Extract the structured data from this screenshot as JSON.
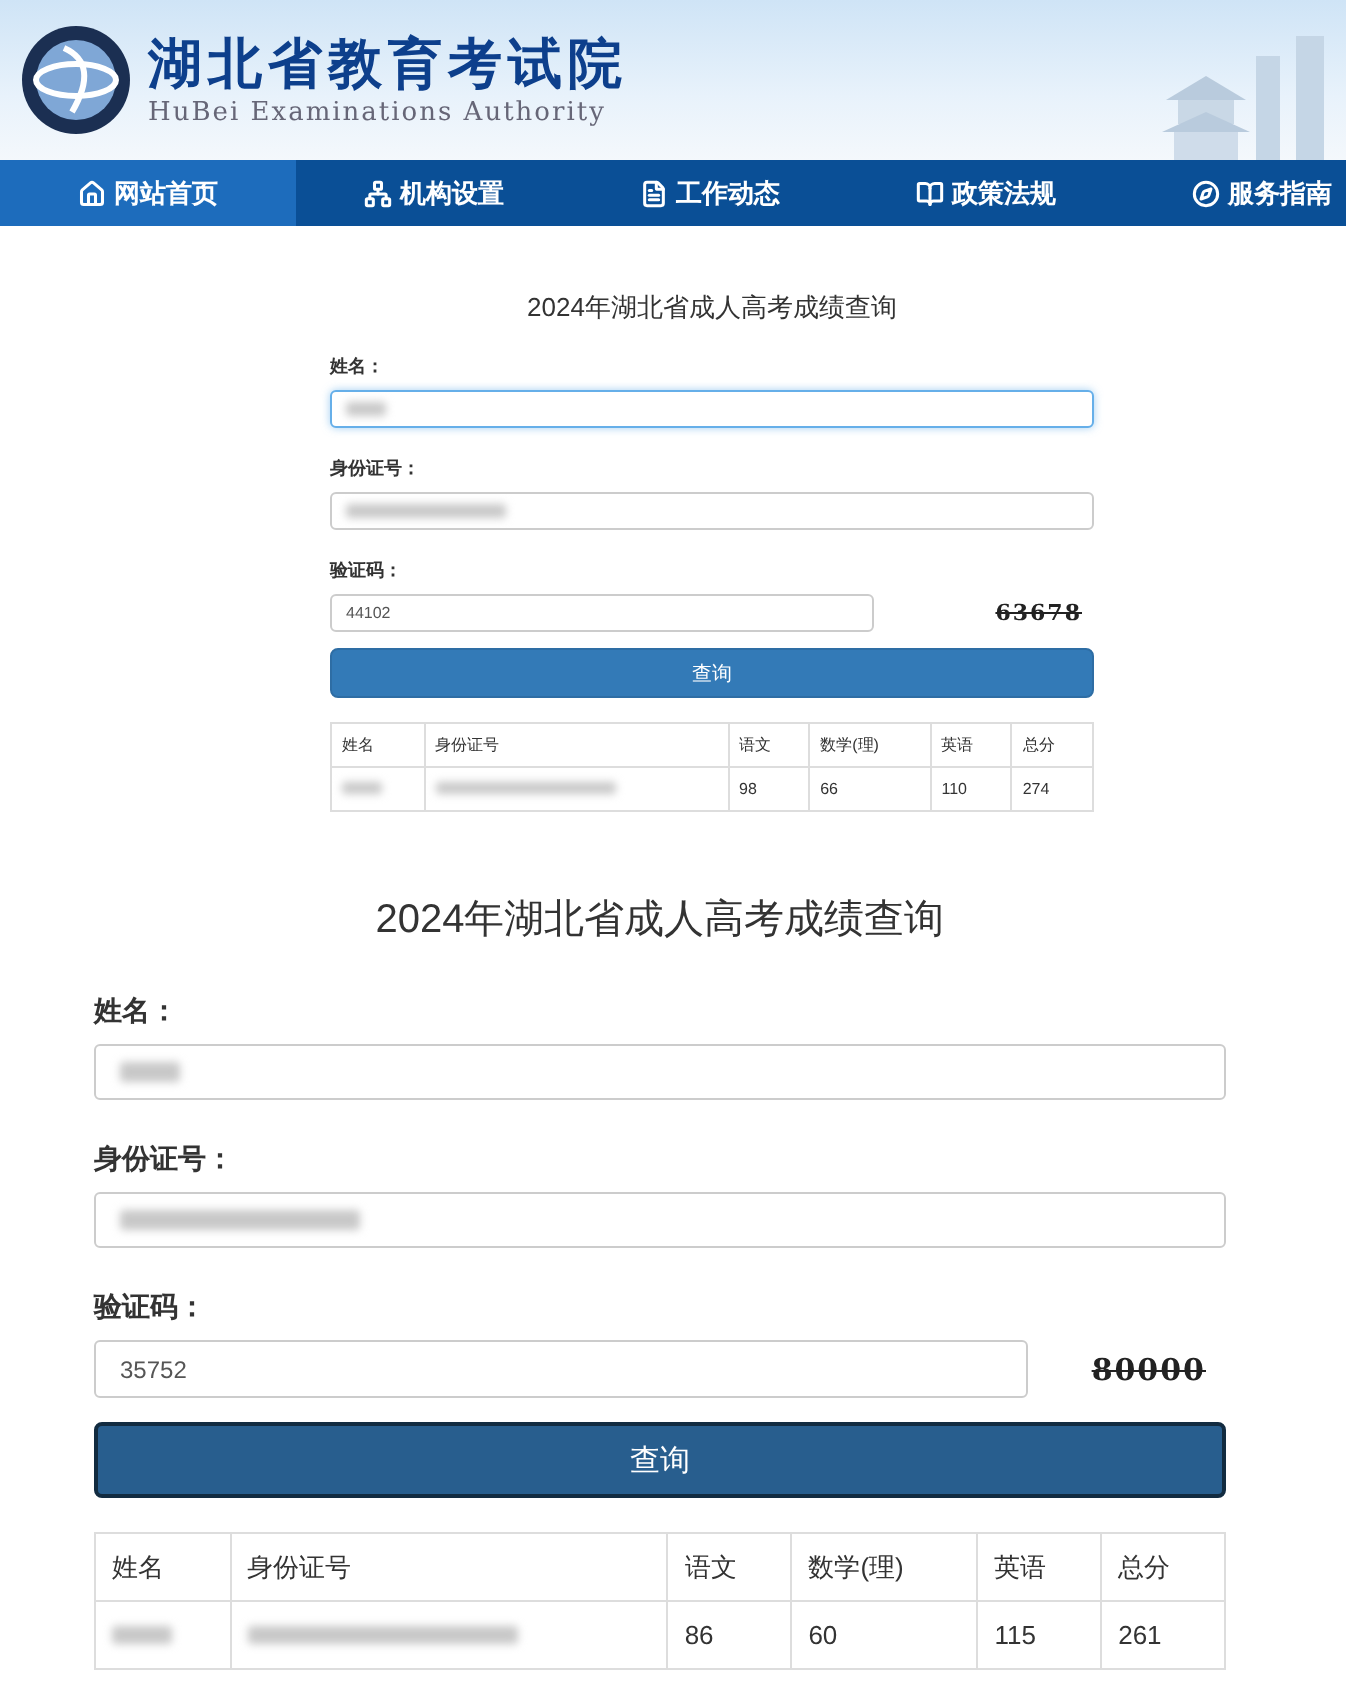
{
  "header": {
    "title": "湖北省教育考试院",
    "subtitle": "HuBei Examinations Authority"
  },
  "nav": [
    {
      "label": "网站首页",
      "selected": true
    },
    {
      "label": "机构设置",
      "selected": false
    },
    {
      "label": "工作动态",
      "selected": false
    },
    {
      "label": "政策法规",
      "selected": false
    },
    {
      "label": "服务指南",
      "selected": false
    }
  ],
  "forms": [
    {
      "kind": "compact",
      "title": "2024年湖北省成人高考成绩查询",
      "fields": [
        {
          "label": "姓名：",
          "redacted": true,
          "focused": true
        },
        {
          "label": "身份证号：",
          "redacted": true,
          "focused": false
        }
      ],
      "captcha": {
        "label": "验证码：",
        "value": "44102",
        "code": "63678"
      },
      "button": "查询",
      "columns": [
        "姓名",
        "身份证号",
        "语文",
        "数学(理)",
        "英语",
        "总分"
      ],
      "rows": [
        [
          {
            "redacted": true
          },
          {
            "redacted": true
          },
          {
            "text": "98"
          },
          {
            "text": "66"
          },
          {
            "text": "110"
          },
          {
            "text": "274"
          }
        ]
      ]
    },
    {
      "kind": "full",
      "title": "2024年湖北省成人高考成绩查询",
      "fields": [
        {
          "label": "姓名：",
          "redacted": true,
          "focused": false
        },
        {
          "label": "身份证号：",
          "redacted": true,
          "focused": false
        }
      ],
      "captcha": {
        "label": "验证码：",
        "value": "35752",
        "code": "80000"
      },
      "button": "查询",
      "columns": [
        "姓名",
        "身份证号",
        "语文",
        "数学(理)",
        "英语",
        "总分"
      ],
      "rows": [
        [
          {
            "redacted": true
          },
          {
            "redacted": true
          },
          {
            "text": "86"
          },
          {
            "text": "60"
          },
          {
            "text": "115"
          },
          {
            "text": "261"
          }
        ]
      ]
    }
  ]
}
